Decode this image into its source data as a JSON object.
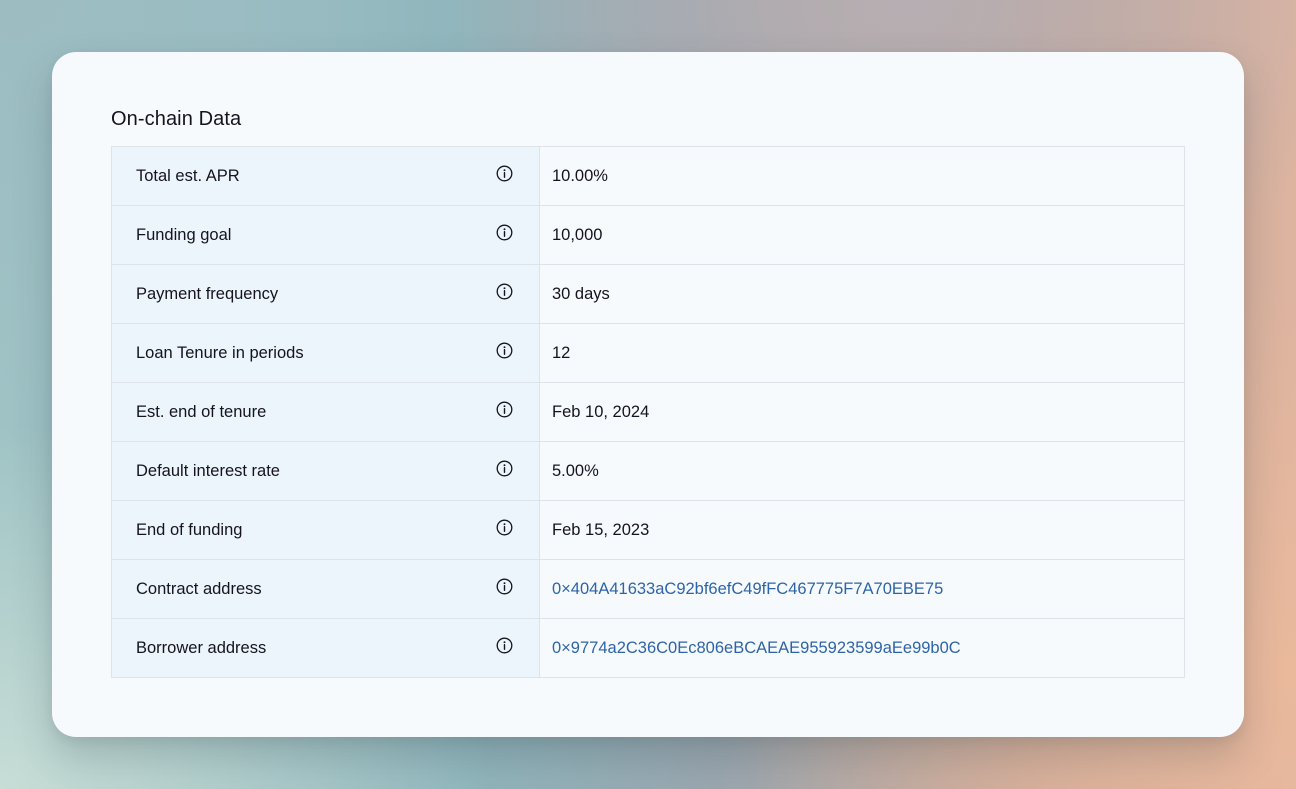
{
  "section": {
    "title": "On-chain Data"
  },
  "rows": [
    {
      "label": "Total est. APR",
      "value": "10.00%",
      "is_link": false
    },
    {
      "label": "Funding goal",
      "value": "10,000",
      "is_link": false
    },
    {
      "label": "Payment frequency",
      "value": "30 days",
      "is_link": false
    },
    {
      "label": "Loan Tenure in periods",
      "value": "12",
      "is_link": false
    },
    {
      "label": "Est. end of tenure",
      "value": "Feb 10, 2024",
      "is_link": false
    },
    {
      "label": "Default interest rate",
      "value": "5.00%",
      "is_link": false
    },
    {
      "label": "End of funding",
      "value": "Feb 15, 2023",
      "is_link": false
    },
    {
      "label": "Contract address",
      "value": "0×404A41633aC92bf6efC49fFC467775F7A70EBE75",
      "is_link": true
    },
    {
      "label": "Borrower address",
      "value": "0×9774a2C36C0Ec806eBCAEAE955923599aEe99b0C",
      "is_link": true
    }
  ],
  "icons": {
    "row_info": "info-icon"
  },
  "colors": {
    "link": "#2d64a7",
    "label_bg": "#ebf5fb",
    "card_bg": "#f7fafd",
    "text": "#15131f"
  }
}
